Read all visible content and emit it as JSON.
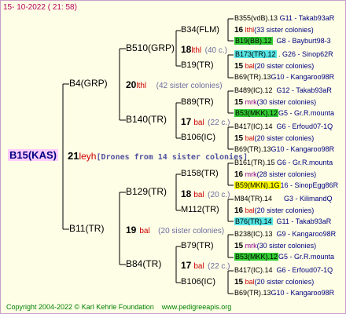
{
  "header": {
    "date": "15- 10-2022 ( 21: 58)"
  },
  "footer": {
    "copyright": "Copyright 2004-2022 © Karl Kehrle Foundation",
    "url": "www.pedigreeapis.org"
  },
  "root": {
    "name": "B15(KAS)",
    "num": "21",
    "origin": "leyh",
    "note": "[Drones from 14 sister colonies]"
  },
  "gen1": [
    {
      "name": "B4(GRP)",
      "num": "20",
      "origin": "lthl",
      "note": "(42 sister colonies)"
    },
    {
      "name": "B11(TR)",
      "num": "19",
      "origin": "bal",
      "note": "(20 sister colonies)"
    }
  ],
  "gen2": [
    {
      "name": "B510(GRP)",
      "num": "18",
      "origin": "lthl",
      "note": "(40 c.)"
    },
    {
      "name": "B140(TR)",
      "num": "17",
      "origin": "bal",
      "note": "(22 c.)"
    },
    {
      "name": "B129(TR)",
      "num": "18",
      "origin": "bal",
      "note": "(20 c.)"
    },
    {
      "name": "B84(TR)",
      "num": "17",
      "origin": "bal",
      "note": "(22 c.)"
    }
  ],
  "gen3": [
    {
      "name": "B34(FLM)"
    },
    {
      "name": "B19(TR)"
    },
    {
      "name": "B89(TR)"
    },
    {
      "name": "B106(IC)"
    },
    {
      "name": "B158(TR)"
    },
    {
      "name": "M112(TR)"
    },
    {
      "name": "B79(TR)"
    },
    {
      "name": "B106(IC)"
    }
  ],
  "leaves": [
    {
      "main": "B355(vdB).13",
      "code": "G11 - Takab93aR"
    },
    {
      "num": "16",
      "origin": "lthl",
      "note": "(33 sister colonies)"
    },
    {
      "main": "B19(BB).12",
      "code": "G8 - Bayburt98-3"
    },
    {
      "main": "B173(TR).12",
      "code": "G26 - Sinop62R"
    },
    {
      "num": "15",
      "origin": "bal",
      "note": "(20 sister colonies)"
    },
    {
      "main": "B69(TR).13",
      "code": "G10 - Kangaroo98R"
    },
    {
      "main": "B489(IC).12",
      "code": "G12 - Takab93aR"
    },
    {
      "num": "15",
      "origin": "mrk",
      "note": "(30 sister colonies)"
    },
    {
      "main": "B53(MKK).12",
      "code": "G5 - Gr.R.mounta"
    },
    {
      "main": "B417(IC).14",
      "code": "G6 - Erfoud07-1Q"
    },
    {
      "num": "15",
      "origin": "bal",
      "note": "(20 sister colonies)"
    },
    {
      "main": "B69(TR).13",
      "code": "G10 - Kangaroo98R"
    },
    {
      "main": "B161(TR).15",
      "code": "G6 - Gr.R.mounta"
    },
    {
      "num": "16",
      "origin": "mrk",
      "note": "(28 sister colonies)"
    },
    {
      "main": "B59(MKN).1G",
      "code": "16 - SinopEgg86R"
    },
    {
      "main": "M84(TR).14",
      "code": "G3 - KilimandQ"
    },
    {
      "num": "16",
      "origin": "bal",
      "note": "(20 sister colonies)"
    },
    {
      "main": "B76(TR).14",
      "code": "G11 - Takab93aR"
    },
    {
      "main": "B238(IC).13",
      "code": "G9 - Kangaroo98R"
    },
    {
      "num": "15",
      "origin": "mrk",
      "note": "(30 sister colonies)"
    },
    {
      "main": "B53(MKK).12",
      "code": "G5 - Gr.R.mounta"
    },
    {
      "main": "B417(IC).14",
      "code": "G6 - Erfoud07-1Q"
    },
    {
      "num": "15",
      "origin": "bal",
      "note": "(20 sister colonies)"
    },
    {
      "main": "B69(TR).13",
      "code": "G10 - Kangaroo98R"
    }
  ]
}
